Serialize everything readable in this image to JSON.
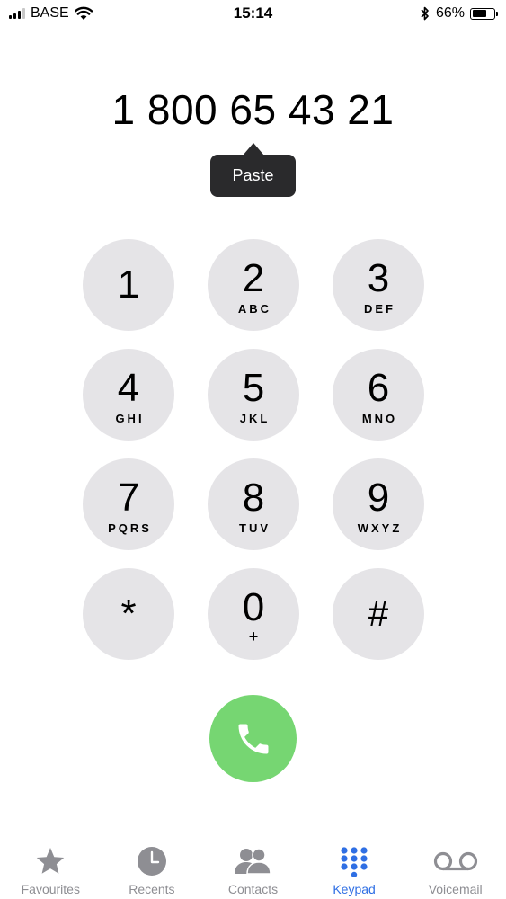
{
  "status_bar": {
    "carrier": "BASE",
    "time": "15:14",
    "battery_percent": "66%",
    "battery_level": 0.66
  },
  "dialer": {
    "number": "1 800 65 43 21",
    "paste_label": "Paste"
  },
  "keypad": {
    "keys": [
      {
        "digit": "1",
        "letters": ""
      },
      {
        "digit": "2",
        "letters": "ABC"
      },
      {
        "digit": "3",
        "letters": "DEF"
      },
      {
        "digit": "4",
        "letters": "GHI"
      },
      {
        "digit": "5",
        "letters": "JKL"
      },
      {
        "digit": "6",
        "letters": "MNO"
      },
      {
        "digit": "7",
        "letters": "PQRS"
      },
      {
        "digit": "8",
        "letters": "TUV"
      },
      {
        "digit": "9",
        "letters": "WXYZ"
      },
      {
        "digit": "*",
        "letters": ""
      },
      {
        "digit": "0",
        "letters": "+"
      },
      {
        "digit": "#",
        "letters": ""
      }
    ]
  },
  "tabs": [
    {
      "label": "Favourites",
      "icon": "star-icon",
      "active": false
    },
    {
      "label": "Recents",
      "icon": "clock-icon",
      "active": false
    },
    {
      "label": "Contacts",
      "icon": "contacts-icon",
      "active": false
    },
    {
      "label": "Keypad",
      "icon": "keypad-icon",
      "active": true
    },
    {
      "label": "Voicemail",
      "icon": "voicemail-icon",
      "active": false
    }
  ],
  "colors": {
    "key_background": "#e5e4e7",
    "call_green": "#76d672",
    "tab_active": "#2f6fe4",
    "tab_inactive": "#8e8e93",
    "tooltip_background": "#2a2a2c"
  }
}
